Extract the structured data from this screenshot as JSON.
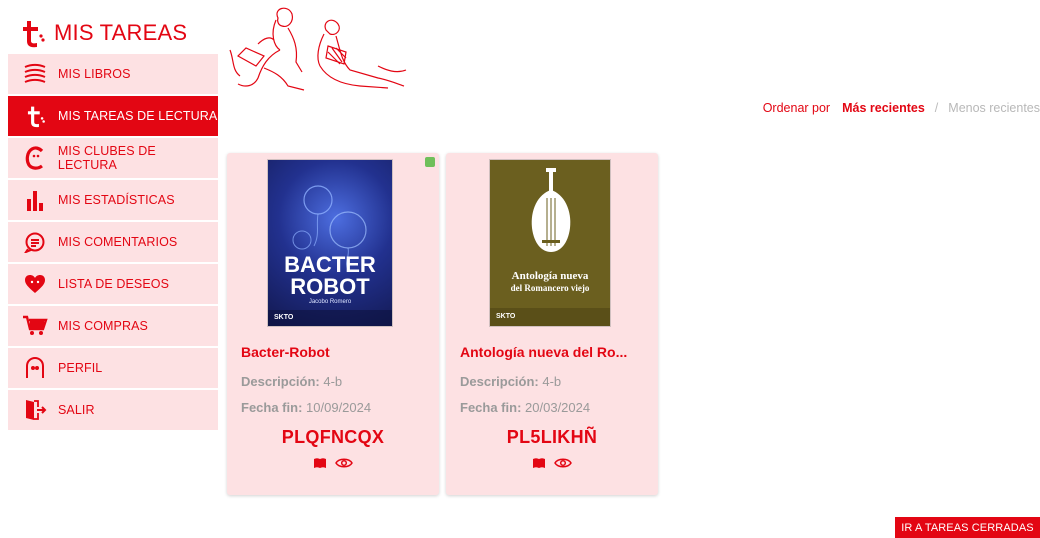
{
  "header": {
    "title": "MIS TAREAS"
  },
  "sidebar": {
    "items": [
      {
        "label": "MIS LIBROS",
        "icon": "books-stack-icon",
        "active": false
      },
      {
        "label": "MIS TAREAS DE LECTURA",
        "icon": "task-t-icon",
        "active": true
      },
      {
        "label": "MIS CLUBES DE LECTURA",
        "icon": "club-c-icon",
        "active": false
      },
      {
        "label": "MIS ESTADÍSTICAS",
        "icon": "bar-chart-icon",
        "active": false
      },
      {
        "label": "MIS COMENTARIOS",
        "icon": "comment-bubble-icon",
        "active": false
      },
      {
        "label": "LISTA DE DESEOS",
        "icon": "heart-icon",
        "active": false
      },
      {
        "label": "MIS COMPRAS",
        "icon": "shopping-cart-icon",
        "active": false
      },
      {
        "label": "PERFIL",
        "icon": "profile-icon",
        "active": false
      },
      {
        "label": "SALIR",
        "icon": "exit-door-icon",
        "active": false
      }
    ]
  },
  "sort": {
    "label": "Ordenar por",
    "active_option": "Más recientes",
    "separator": "/",
    "inactive_option": "Menos recientes"
  },
  "cards": [
    {
      "title": "Bacter-Robot",
      "description_label": "Descripción:",
      "description_value": "4-b",
      "end_label": "Fecha fin:",
      "end_value": "10/09/2024",
      "code": "PLQFNCQX",
      "cover": {
        "line1": "BACTER",
        "line2": "ROBOT",
        "author": "Jacobo Romero",
        "publisher": "SKTO"
      }
    },
    {
      "title": "Antología nueva del Ro...",
      "description_label": "Descripción:",
      "description_value": "4-b",
      "end_label": "Fecha fin:",
      "end_value": "20/03/2024",
      "code": "PL5LIKHÑ",
      "cover": {
        "line1": "Antología nueva",
        "line2": "del Romancero viejo",
        "publisher": "SKTO"
      }
    }
  ],
  "footer": {
    "closed_tasks_button": "IR A TAREAS CERRADAS"
  },
  "colors": {
    "brand_red": "#e30613",
    "card_bg": "#fde1e3",
    "muted_text": "#9a9a9a"
  }
}
